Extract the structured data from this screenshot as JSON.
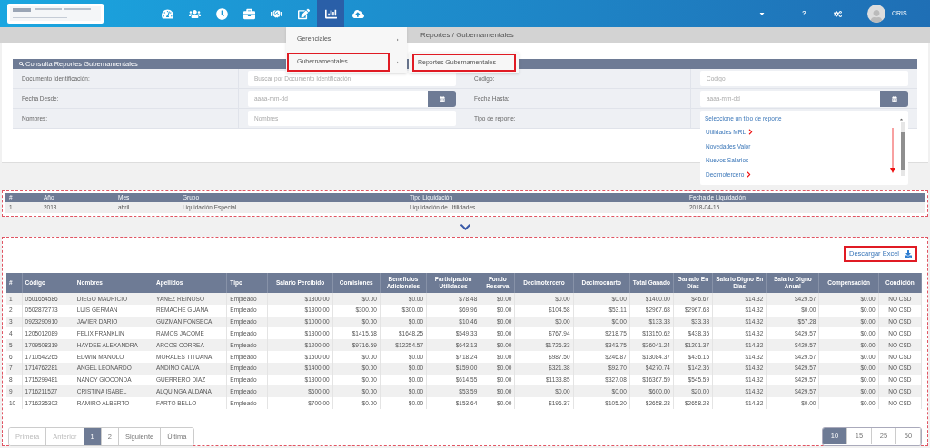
{
  "nav": {
    "tabs": [
      {
        "selected": false
      },
      {
        "selected": false
      },
      {
        "selected": false
      },
      {
        "selected": false
      },
      {
        "selected": false
      },
      {
        "selected": false
      },
      {
        "selected": true
      },
      {
        "selected": false
      }
    ],
    "help": "?",
    "user": "CRIS"
  },
  "breadcrumb": "Reportes / Gubernamentales",
  "menu": {
    "items": [
      {
        "label": "Gerenciales",
        "highlighted": false
      },
      {
        "label": "Gubernamentales",
        "highlighted": true
      }
    ],
    "submenu": [
      {
        "label": "Reportes Gubernamentales",
        "highlighted": true
      }
    ]
  },
  "form": {
    "title": "Consulta Reportes Gubernamentales",
    "rows": [
      [
        {
          "label": "Documento Identificación:",
          "kind": "text",
          "placeholder": "Buscar por Documento Identificación"
        },
        {
          "label": "Codigo:",
          "kind": "text",
          "placeholder": "Codigo"
        }
      ],
      [
        {
          "label": "Fecha Desde:",
          "kind": "date",
          "placeholder": "aaaa-mm-dd"
        },
        {
          "label": "Fecha Hasta:",
          "kind": "date",
          "placeholder": "aaaa-mm-dd"
        }
      ],
      [
        {
          "label": "Nombres:",
          "kind": "text",
          "placeholder": "Nombres"
        },
        {
          "label": "Tipo de reporte:",
          "kind": "select",
          "value": "Seleccione un tipo de reporte",
          "options": [
            {
              "label": "Utilidades MRL",
              "marked": true
            },
            {
              "label": "Novedades Valor",
              "marked": false
            },
            {
              "label": "Nuevos Salarios",
              "marked": false
            },
            {
              "label": "Decimotercero",
              "marked": true
            }
          ]
        }
      ]
    ]
  },
  "summary_table": {
    "columns": [
      "#",
      "Año",
      "Mes",
      "Grupo",
      "Tipo Liquidación",
      "Fecha de Liquidación"
    ],
    "rows": [
      [
        "1",
        "2018",
        "abril",
        "Liquidación Especial",
        "Liquidación de Utilidades",
        "2018-04-15"
      ]
    ]
  },
  "download_button": "Descargar Excel",
  "results_table": {
    "columns": [
      "#",
      "Código",
      "Nombres",
      "Apellidos",
      "Tipo",
      "Salario Percibido",
      "Comisiones",
      "Beneficios Adicionales",
      "Participación Utilidades",
      "Fondo Reserva",
      "Decimotercero",
      "Decimocuarto",
      "Total Ganado",
      "Ganado En Días",
      "Salario Digno En Días",
      "Salario Digno Anual",
      "Compensación",
      "Condición"
    ],
    "rows": [
      [
        "1",
        "0501654586",
        "DIEGO MAURICIO",
        "YANEZ REINOSO",
        "Empleado",
        "$1800.00",
        "$0.00",
        "$0.00",
        "$78.48",
        "$0.00",
        "$0.00",
        "$0.00",
        "$1400.00",
        "$46.67",
        "$14.32",
        "$429.57",
        "$0.00",
        "NO CSD"
      ],
      [
        "2",
        "0502872773",
        "LUIS GERMAN",
        "REMACHE GUANA",
        "Empleado",
        "$1300.00",
        "$300.00",
        "$300.00",
        "$69.96",
        "$0.00",
        "$104.58",
        "$53.11",
        "$2967.68",
        "$2967.68",
        "$14.32",
        "$0.00",
        "$0.00",
        "NO CSD"
      ],
      [
        "3",
        "0923290910",
        "JAVIER DARIO",
        "GUZMAN FONSECA",
        "Empleado",
        "$1000.00",
        "$0.00",
        "$0.00",
        "$10.46",
        "$0.00",
        "$0.00",
        "$0.00",
        "$133.33",
        "$33.33",
        "$14.32",
        "$57.28",
        "$0.00",
        "NO CSD"
      ],
      [
        "4",
        "1205012089",
        "FELIX FRANKLIN",
        "RAMOS JACOME",
        "Empleado",
        "$1300.00",
        "$1415.68",
        "$1648.25",
        "$549.33",
        "$0.00",
        "$767.94",
        "$218.75",
        "$13150.62",
        "$438.35",
        "$14.32",
        "$429.57",
        "$0.00",
        "NO CSD"
      ],
      [
        "5",
        "1709508319",
        "HAYDEE ALEXANDRA",
        "ARCOS CORREA",
        "Empleado",
        "$1200.00",
        "$9716.59",
        "$12254.57",
        "$643.13",
        "$0.00",
        "$1726.33",
        "$343.75",
        "$36041.24",
        "$1201.37",
        "$14.32",
        "$429.57",
        "$0.00",
        "NO CSD"
      ],
      [
        "6",
        "1710542265",
        "EDWIN MANOLO",
        "MORALES TITUANA",
        "Empleado",
        "$1500.00",
        "$0.00",
        "$0.00",
        "$718.24",
        "$0.00",
        "$987.50",
        "$246.87",
        "$13084.37",
        "$436.15",
        "$14.32",
        "$429.57",
        "$0.00",
        "NO CSD"
      ],
      [
        "7",
        "1714762281",
        "ANGEL LEONARDO",
        "ANDINO CALVA",
        "Empleado",
        "$1400.00",
        "$0.00",
        "$0.00",
        "$159.00",
        "$0.00",
        "$321.38",
        "$92.70",
        "$4270.74",
        "$142.36",
        "$14.32",
        "$429.57",
        "$0.00",
        "NO CSD"
      ],
      [
        "8",
        "1715299481",
        "NANCY GIOCONDA",
        "GUERRERO DIAZ",
        "Empleado",
        "$1300.00",
        "$0.00",
        "$0.00",
        "$614.55",
        "$0.00",
        "$1133.85",
        "$327.08",
        "$16367.59",
        "$545.59",
        "$14.32",
        "$429.57",
        "$0.00",
        "NO CSD"
      ],
      [
        "9",
        "1716211527",
        "CRISTINA ISABEL",
        "ALQUINGA ALDANA",
        "Empleado",
        "$600.00",
        "$0.00",
        "$0.00",
        "$53.59",
        "$0.00",
        "$0.00",
        "$0.00",
        "$600.00",
        "$20.00",
        "$14.32",
        "$429.57",
        "$0.00",
        "NO CSD"
      ],
      [
        "10",
        "1716235302",
        "RAMIRO ALBERTO",
        "FARTO BELLO",
        "Empleado",
        "$700.00",
        "$0.00",
        "$0.00",
        "$153.64",
        "$0.00",
        "$196.37",
        "$105.20",
        "$2658.23",
        "$2658.23",
        "$14.32",
        "$0.00",
        "$0.00",
        "NO CSD"
      ]
    ]
  },
  "pagination": [
    {
      "label": "Primera",
      "selected": false,
      "disabled": true
    },
    {
      "label": "Anterior",
      "selected": false,
      "disabled": true
    },
    {
      "label": "1",
      "selected": true,
      "disabled": false
    },
    {
      "label": "2",
      "selected": false,
      "disabled": false
    },
    {
      "label": "Siguiente",
      "selected": false,
      "disabled": false
    },
    {
      "label": "Última",
      "selected": false,
      "disabled": false
    }
  ],
  "page_sizes": [
    {
      "label": "10",
      "selected": true
    },
    {
      "label": "15",
      "selected": false
    },
    {
      "label": "25",
      "selected": false
    },
    {
      "label": "50",
      "selected": false
    }
  ]
}
